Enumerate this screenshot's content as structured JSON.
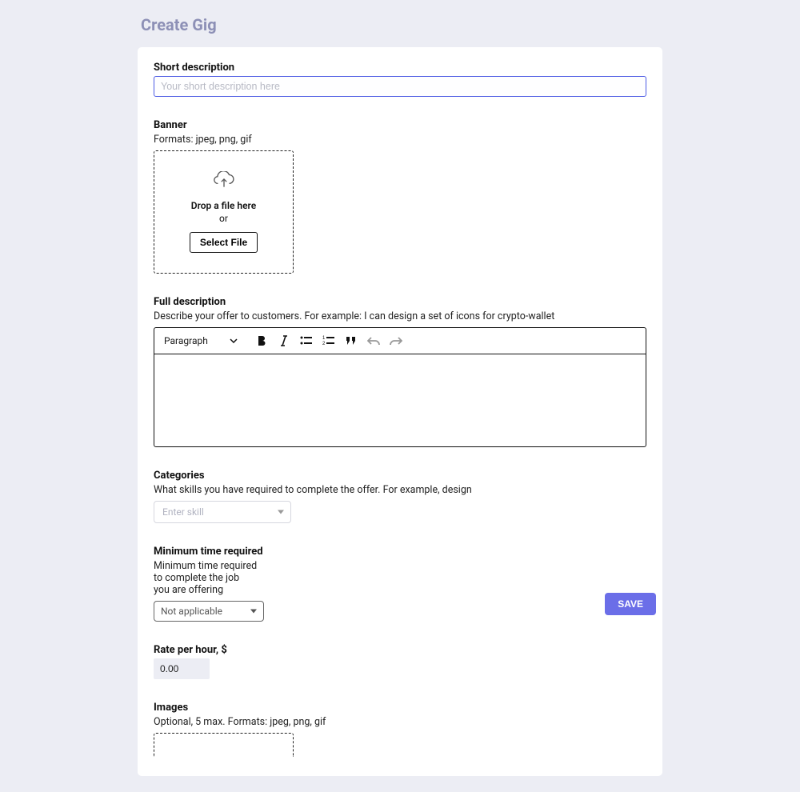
{
  "pageTitle": "Create Gig",
  "shortDescription": {
    "label": "Short description",
    "placeholder": "Your short description here",
    "value": ""
  },
  "banner": {
    "label": "Banner",
    "formats": "Formats: jpeg, png, gif",
    "dropText": "Drop a file here",
    "orText": "or",
    "button": "Select File"
  },
  "fullDescription": {
    "label": "Full description",
    "help": "Describe your offer to customers. For example: I can design a set of icons for crypto-wallet",
    "paragraphLabel": "Paragraph"
  },
  "categories": {
    "label": "Categories",
    "help": "What skills you have required to complete the offer. For example, design",
    "placeholder": "Enter skill"
  },
  "minTime": {
    "label": "Minimum time required",
    "help": "Minimum time required to complete the job you are offering",
    "value": "Not applicable"
  },
  "rate": {
    "label": "Rate per hour, $",
    "value": "0.00"
  },
  "images": {
    "label": "Images",
    "help": "Optional, 5 max. Formats: jpeg, png, gif"
  },
  "saveButton": "SAVE"
}
